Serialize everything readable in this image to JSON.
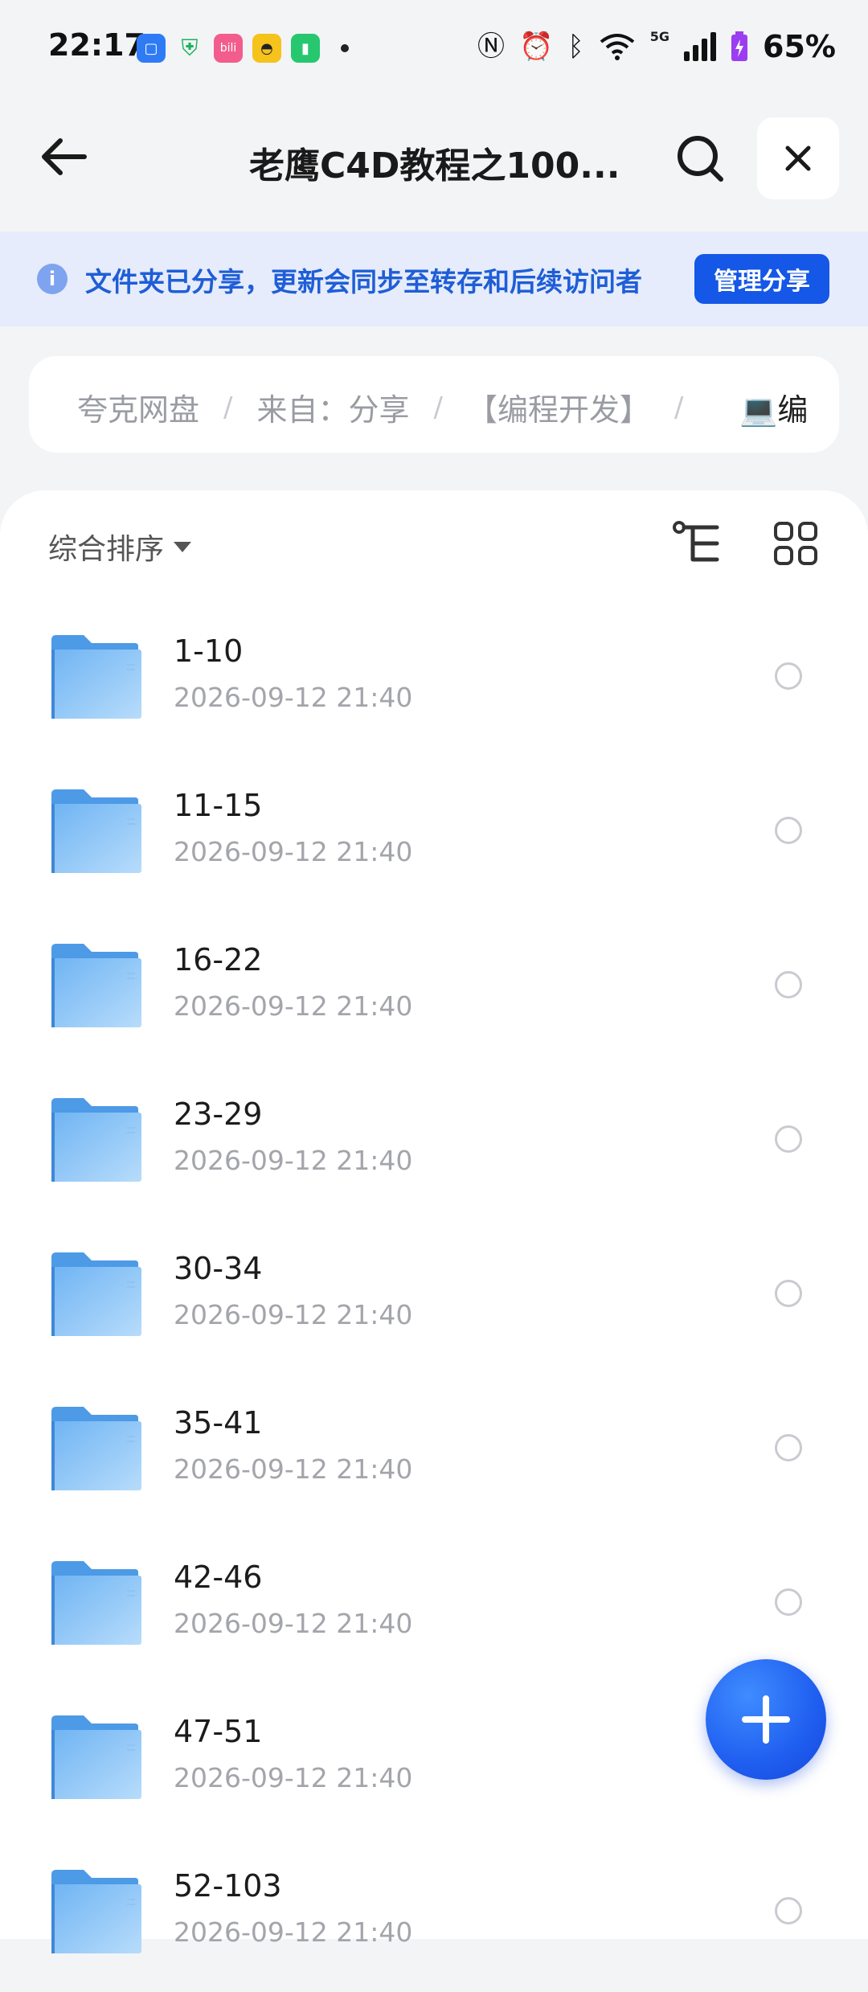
{
  "status_bar": {
    "time": "22:17",
    "battery": "65%",
    "network": "5G"
  },
  "header": {
    "title": "老鹰C4D教程之100...",
    "back_icon": "arrow-left-icon",
    "search_icon": "search-icon",
    "close_icon": "close-icon"
  },
  "share_banner": {
    "message": "文件夹已分享，更新会同步至转存和后续访问者",
    "button_label": "管理分享"
  },
  "breadcrumb": {
    "items": [
      "夸克网盘",
      "来自：分享",
      "【编程开发】",
      "💻编"
    ]
  },
  "toolbar": {
    "sort_label": "综合排序"
  },
  "files": [
    {
      "name": "1-10",
      "date": "2026-09-12 21:40"
    },
    {
      "name": "11-15",
      "date": "2026-09-12 21:40"
    },
    {
      "name": "16-22",
      "date": "2026-09-12 21:40"
    },
    {
      "name": "23-29",
      "date": "2026-09-12 21:40"
    },
    {
      "name": "30-34",
      "date": "2026-09-12 21:40"
    },
    {
      "name": "35-41",
      "date": "2026-09-12 21:40"
    },
    {
      "name": "42-46",
      "date": "2026-09-12 21:40"
    },
    {
      "name": "47-51",
      "date": "2026-09-12 21:40"
    },
    {
      "name": "52-103",
      "date": "2026-09-12 21:40"
    }
  ],
  "colors": {
    "accent": "#1557e6",
    "banner_bg": "#e6ecfb",
    "folder": "#5aa9f0"
  }
}
